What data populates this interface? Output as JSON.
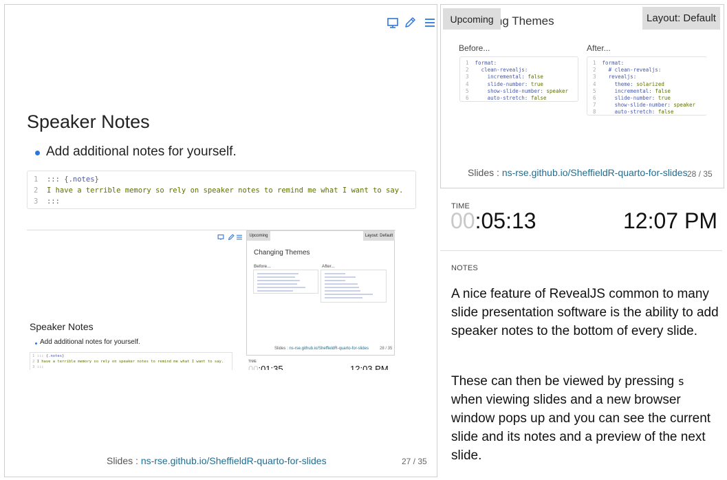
{
  "current_slide": {
    "title": "Speaker Notes",
    "bullet": "Add additional notes for yourself.",
    "code": [
      {
        "n": "1",
        "parts": [
          [
            "c-op",
            "::: "
          ],
          [
            "c-op",
            "{"
          ],
          [
            "c-attr",
            ".notes"
          ],
          [
            "c-op",
            "}"
          ]
        ]
      },
      {
        "n": "2",
        "parts": [
          [
            "c-str",
            "I have a terrible memory so rely on speaker notes to remind me what I want to say."
          ]
        ]
      },
      {
        "n": "3",
        "parts": [
          [
            "c-op",
            ":::"
          ]
        ]
      }
    ],
    "footer_prefix": "Slides : ",
    "footer_link": "ns-rse.github.io/SheffieldR-quarto-for-slides",
    "slide_number": "27 / 35",
    "icons": [
      "slides-icon",
      "pen-icon",
      "menu-icon"
    ]
  },
  "snapshot": {
    "upcoming_badge": "Upcoming",
    "layout_badge": "Layout: Default",
    "next_title": "Changing Themes",
    "before": "Before...",
    "after": "After...",
    "footer_prefix": "Slides : ",
    "footer_link": "ns-rse.github.io/SheffieldR-quarto-for-slides",
    "slide_number": "28 / 35",
    "time_label": "TIME",
    "timer_hours": "00",
    "timer_rest": ":01:35",
    "clock": "12:03 PM",
    "title": "Speaker Notes",
    "bullet": "Add additional notes for yourself."
  },
  "upcoming_slide": {
    "badge": "Upcoming",
    "title": "Changing Themes",
    "before_label": "Before...",
    "after_label": "After...",
    "before_code": [
      {
        "n": "1",
        "t": "format:"
      },
      {
        "n": "2",
        "t": "  clean-revealjs:"
      },
      {
        "n": "3",
        "t": "    incremental: false"
      },
      {
        "n": "4",
        "t": "    slide-number: true"
      },
      {
        "n": "5",
        "t": "    show-slide-number: speaker"
      },
      {
        "n": "6",
        "t": "    auto-stretch: false"
      }
    ],
    "after_code": [
      {
        "n": "1",
        "t": "format:"
      },
      {
        "n": "2",
        "t": "  # clean-revealjs:"
      },
      {
        "n": "3",
        "t": "  revealjs:"
      },
      {
        "n": "4",
        "t": "    theme: solarized"
      },
      {
        "n": "5",
        "t": "    incremental: false"
      },
      {
        "n": "6",
        "t": "    slide-number: true"
      },
      {
        "n": "7",
        "t": "    show-slide-number: speaker"
      },
      {
        "n": "8",
        "t": "    auto-stretch: false"
      }
    ],
    "footer_prefix": "Slides : ",
    "footer_link": "ns-rse.github.io/SheffieldR-quarto-for-slides",
    "slide_number": "28 / 35"
  },
  "layout_button": "Layout: Default",
  "time": {
    "label": "TIME",
    "timer_hours": "00",
    "timer_rest": ":05:13",
    "clock": "12:07 PM"
  },
  "notes": {
    "label": "NOTES",
    "p1": "A nice feature of RevealJS common to many slide presentation software is the ability to add speaker notes to the bottom of every slide.",
    "p2_before": "These can then be viewed by pressing ",
    "p2_key": "s",
    "p2_after": "when viewing slides and a new browser window pops up and you can see the current slide and its notes and a preview of the next slide."
  },
  "colors": {
    "accent": "#2a76dd",
    "link": "#1d6d93",
    "badge_bg": "#dddddd"
  }
}
